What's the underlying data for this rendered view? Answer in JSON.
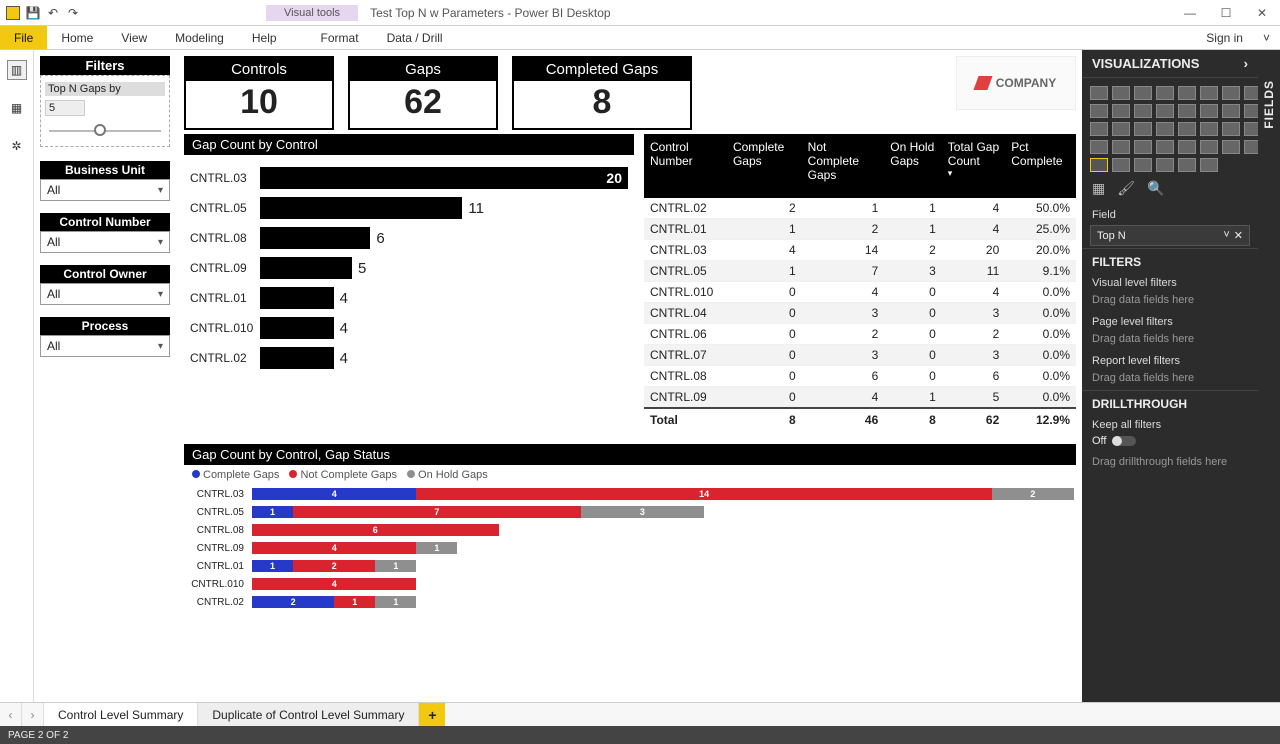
{
  "window": {
    "contextual_tab": "Visual tools",
    "title": "Test Top N w Parameters - Power BI Desktop",
    "sign_in": "Sign in"
  },
  "ribbon": {
    "file": "File",
    "tabs": [
      "Home",
      "View",
      "Modeling",
      "Help",
      "Format",
      "Data / Drill"
    ]
  },
  "status": "PAGE 2 OF 2",
  "page_tabs": {
    "tab1": "Control Level Summary",
    "tab2": "Duplicate of Control Level Summary"
  },
  "right": {
    "viz_header": "VISUALIZATIONS",
    "fields_header": "FIELDS",
    "field_label": "Field",
    "field_value": "Top N",
    "filters_header": "FILTERS",
    "visual_filters": "Visual level filters",
    "page_filters": "Page level filters",
    "report_filters": "Report level filters",
    "drag_hint": "Drag data fields here",
    "drill_header": "DRILLTHROUGH",
    "keep_all": "Keep all filters",
    "off": "Off",
    "drill_hint": "Drag drillthrough fields here"
  },
  "filters_panel": {
    "title": "Filters",
    "slicer_header": "Top N Gaps by",
    "slicer_value": "5",
    "bu": {
      "label": "Business Unit",
      "value": "All"
    },
    "cn": {
      "label": "Control Number",
      "value": "All"
    },
    "co": {
      "label": "Control Owner",
      "value": "All"
    },
    "pr": {
      "label": "Process",
      "value": "All"
    }
  },
  "cards": {
    "controls": {
      "label": "Controls",
      "value": "10"
    },
    "gaps": {
      "label": "Gaps",
      "value": "62"
    },
    "completed": {
      "label": "Completed Gaps",
      "value": "8"
    }
  },
  "logo": "COMPANY",
  "chart_data": [
    {
      "id": "gap_by_control",
      "type": "bar",
      "title": "Gap Count by Control",
      "orientation": "horizontal",
      "categories": [
        "CNTRL.03",
        "CNTRL.05",
        "CNTRL.08",
        "CNTRL.09",
        "CNTRL.01",
        "CNTRL.010",
        "CNTRL.02"
      ],
      "values": [
        20,
        11,
        6,
        5,
        4,
        4,
        4
      ],
      "xlim": [
        0,
        20
      ]
    },
    {
      "id": "gap_table",
      "type": "table",
      "columns": [
        "Control Number",
        "Complete Gaps",
        "Not Complete Gaps",
        "On Hold Gaps",
        "Total Gap Count",
        "Pct Complete"
      ],
      "rows": [
        [
          "CNTRL.02",
          2,
          1,
          1,
          4,
          "50.0%"
        ],
        [
          "CNTRL.01",
          1,
          2,
          1,
          4,
          "25.0%"
        ],
        [
          "CNTRL.03",
          4,
          14,
          2,
          20,
          "20.0%"
        ],
        [
          "CNTRL.05",
          1,
          7,
          3,
          11,
          "9.1%"
        ],
        [
          "CNTRL.010",
          0,
          4,
          0,
          4,
          "0.0%"
        ],
        [
          "CNTRL.04",
          0,
          3,
          0,
          3,
          "0.0%"
        ],
        [
          "CNTRL.06",
          0,
          2,
          0,
          2,
          "0.0%"
        ],
        [
          "CNTRL.07",
          0,
          3,
          0,
          3,
          "0.0%"
        ],
        [
          "CNTRL.08",
          0,
          6,
          0,
          6,
          "0.0%"
        ],
        [
          "CNTRL.09",
          0,
          4,
          1,
          5,
          "0.0%"
        ]
      ],
      "totals": [
        "Total",
        8,
        46,
        8,
        62,
        "12.9%"
      ]
    },
    {
      "id": "gap_by_status",
      "type": "bar",
      "title": "Gap Count by Control, Gap Status",
      "orientation": "horizontal",
      "stacked": true,
      "categories": [
        "CNTRL.03",
        "CNTRL.05",
        "CNTRL.08",
        "CNTRL.09",
        "CNTRL.01",
        "CNTRL.010",
        "CNTRL.02"
      ],
      "series": [
        {
          "name": "Complete Gaps",
          "color": "#2639c9",
          "values": [
            4,
            1,
            0,
            0,
            1,
            0,
            2
          ]
        },
        {
          "name": "Not Complete Gaps",
          "color": "#d9232e",
          "values": [
            14,
            7,
            6,
            4,
            2,
            4,
            1
          ]
        },
        {
          "name": "On Hold Gaps",
          "color": "#8f8f8f",
          "values": [
            2,
            3,
            0,
            1,
            1,
            0,
            1
          ]
        }
      ],
      "xlim": [
        0,
        20
      ]
    }
  ]
}
